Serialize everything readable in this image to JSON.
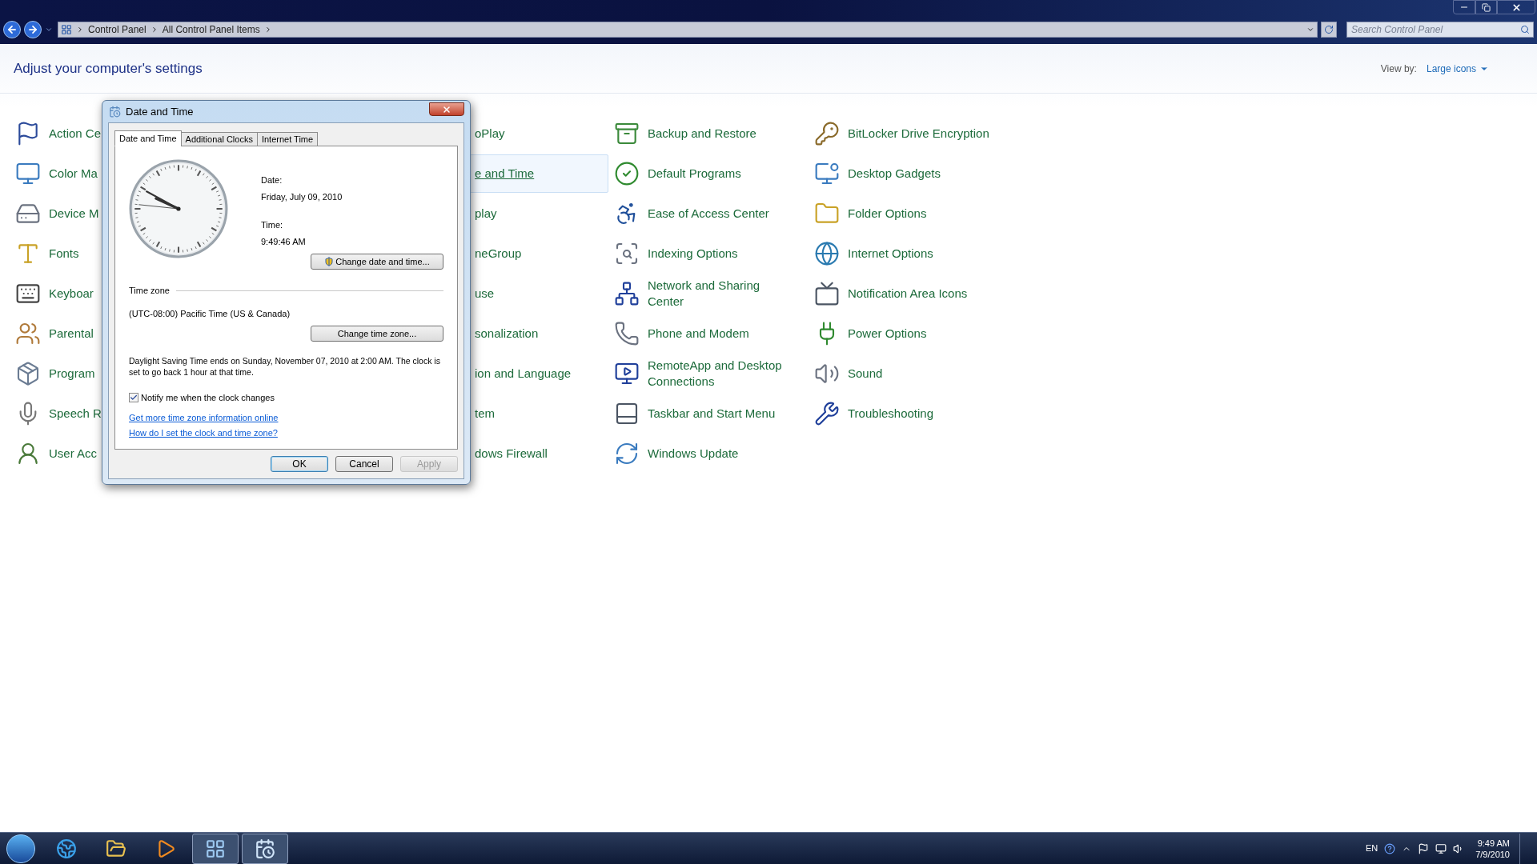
{
  "window": {
    "breadcrumb": [
      "Control Panel",
      "All Control Panel Items"
    ],
    "search": {
      "placeholder": "Search Control Panel"
    }
  },
  "header": {
    "title": "Adjust your computer's settings",
    "view_by_label": "View by:",
    "view_by_value": "Large icons"
  },
  "columns": [
    [
      {
        "label": "Action Ce",
        "selected": false
      },
      {
        "label": "Color Ma",
        "selected": false
      },
      {
        "label": "Device M",
        "selected": false
      },
      {
        "label": "Fonts",
        "selected": false
      },
      {
        "label": "Keyboar",
        "selected": false
      },
      {
        "label": "Parental",
        "selected": false
      },
      {
        "label": "Program",
        "selected": false
      },
      {
        "label": "Speech R",
        "selected": false
      },
      {
        "label": "User Acc",
        "selected": false
      }
    ],
    [
      {
        "label": "oPlay",
        "selected": false
      },
      {
        "label": "e and Time",
        "selected": true
      },
      {
        "label": "play",
        "selected": false
      },
      {
        "label": "neGroup",
        "selected": false
      },
      {
        "label": "use",
        "selected": false
      },
      {
        "label": "sonalization",
        "selected": false
      },
      {
        "label": "ion and Language",
        "selected": false
      },
      {
        "label": "tem",
        "selected": false
      },
      {
        "label": "dows Firewall",
        "selected": false
      }
    ],
    [
      {
        "label": "Backup and Restore",
        "selected": false
      },
      {
        "label": "Default Programs",
        "selected": false
      },
      {
        "label": "Ease of Access Center",
        "selected": false
      },
      {
        "label": "Indexing Options",
        "selected": false
      },
      {
        "label": "Network and Sharing Center",
        "selected": false
      },
      {
        "label": "Phone and Modem",
        "selected": false
      },
      {
        "label": "RemoteApp and Desktop Connections",
        "selected": false
      },
      {
        "label": "Taskbar and Start Menu",
        "selected": false
      },
      {
        "label": "Windows Update",
        "selected": false
      }
    ],
    [
      {
        "label": "BitLocker Drive Encryption",
        "selected": false
      },
      {
        "label": "Desktop Gadgets",
        "selected": false
      },
      {
        "label": "Folder Options",
        "selected": false
      },
      {
        "label": "Internet Options",
        "selected": false
      },
      {
        "label": "Notification Area Icons",
        "selected": false
      },
      {
        "label": "Power Options",
        "selected": false
      },
      {
        "label": "Sound",
        "selected": false
      },
      {
        "label": "Troubleshooting",
        "selected": false
      }
    ]
  ],
  "dialog": {
    "title": "Date and Time",
    "tabs": [
      {
        "label": "Date and Time",
        "selected": true
      },
      {
        "label": "Additional Clocks",
        "selected": false
      },
      {
        "label": "Internet Time",
        "selected": false
      }
    ],
    "date_label": "Date:",
    "date": "Friday, July 09, 2010",
    "time_label": "Time:",
    "time": "9:49:46 AM",
    "change_datetime_button": "Change date and time...",
    "timezone_group": "Time zone",
    "timezone": "(UTC-08:00) Pacific Time (US & Canada)",
    "change_timezone_button": "Change time zone...",
    "dst_note": "Daylight Saving Time ends on Sunday, November 07, 2010 at 2:00 AM. The clock is set to go back 1 hour at that time.",
    "notify": {
      "label": "Notify me when the clock changes",
      "checked": true
    },
    "links": [
      "Get more time zone information online",
      "How do I set the clock and time zone?"
    ],
    "buttons": [
      {
        "label": "OK",
        "kind": "default"
      },
      {
        "label": "Cancel",
        "kind": "normal"
      },
      {
        "label": "Apply",
        "kind": "disabled"
      }
    ]
  },
  "taskbar": {
    "apps": [
      {
        "active": false
      },
      {
        "active": false
      },
      {
        "active": false
      },
      {
        "active": true
      },
      {
        "active": true
      }
    ],
    "tray": {
      "language": "EN",
      "time": "9:49 AM",
      "date": "7/9/2010"
    }
  }
}
